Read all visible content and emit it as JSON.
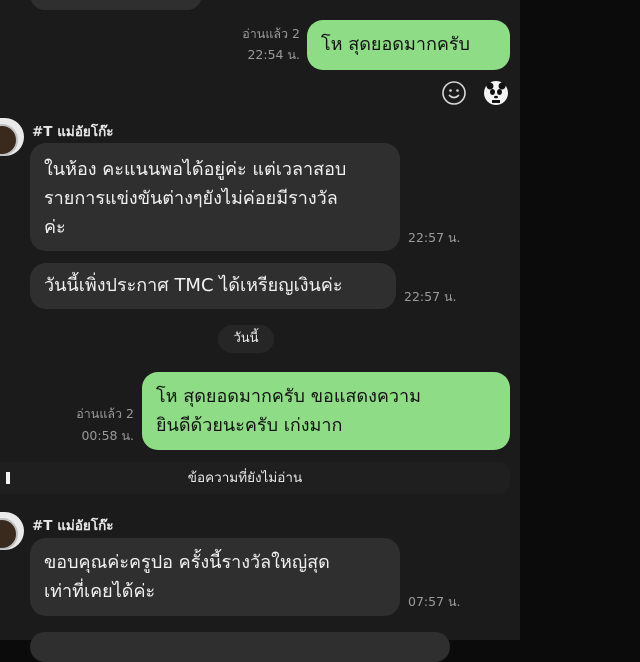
{
  "messages": {
    "top_out": {
      "read": "อ่านแล้ว 2",
      "time": "22:54 น.",
      "text": "โห สุดยอดมากครับ"
    },
    "sender1": "#T แม่อัยโก๊ะ",
    "in1": {
      "lines": [
        "ในห้อง คะแนนพอได้อยู่ค่ะ แต่เวลาสอบ",
        "รายการแข่งขันต่างๆยังไม่ค่อยมีรางวัล",
        "ค่ะ"
      ],
      "time": "22:57 น."
    },
    "in2": {
      "text": "วันนี้เพิ่งประกาศ TMC ได้เหรียญเงินค่ะ",
      "time": "22:57 น."
    },
    "date_divider": "วันนี้",
    "out2": {
      "read": "อ่านแล้ว 2",
      "time": "00:58 น.",
      "lines": [
        "โห สุดยอดมากครับ  ขอแสดงความ",
        "ยินดีด้วยนะครับ เก่งมาก"
      ]
    },
    "unread_divider": "ข้อความที่ยังไม่อ่าน",
    "sender2": "#T แม่อัยโก๊ะ",
    "in3": {
      "lines": [
        "ขอบคุณค่ะครูปอ ครั้งนี้รางวัลใหญ่สุด",
        "เท่าที่เคยได้ค่ะ"
      ],
      "time": "07:57 น."
    }
  },
  "icons": [
    "smiley-icon",
    "panda-sticker-icon"
  ]
}
